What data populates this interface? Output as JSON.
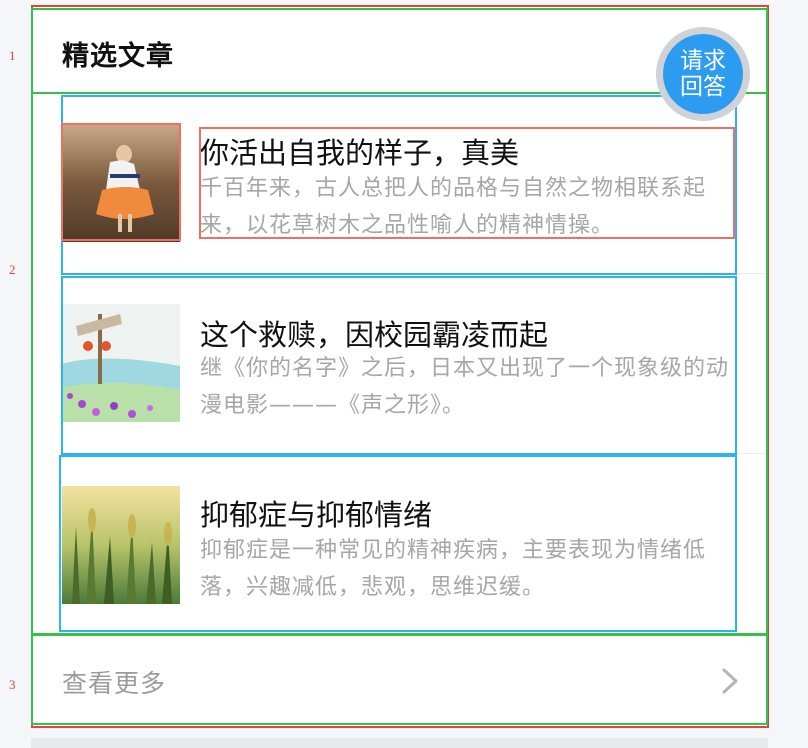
{
  "annotations": {
    "region_1": "1",
    "region_2": "2",
    "region_3": "3"
  },
  "section": {
    "title": "精选文章"
  },
  "ask_button": {
    "line1": "请求",
    "line2": "回答"
  },
  "articles": [
    {
      "title": "你活出自我的样子，真美",
      "desc": "千百年来，古人总把人的品格与自然之物相联系起来，以花草树木之品性喻人的精神情操。"
    },
    {
      "title": "这个救赎，因校园霸凌而起",
      "desc": "继《你的名字》之后，日本又出现了一个现象级的动漫电影———《声之形》。"
    },
    {
      "title": "抑郁症与抑郁情绪",
      "desc": "抑郁症是一种常见的精神疾病，主要表现为情绪低落，兴趣减低，悲观，思维迟缓。"
    }
  ],
  "footer": {
    "more_label": "查看更多"
  },
  "colors": {
    "accent": "#2d9cf0",
    "title": "#111111",
    "muted": "#a6a6a6"
  },
  "icons": {
    "more": "chevron-right-icon"
  }
}
